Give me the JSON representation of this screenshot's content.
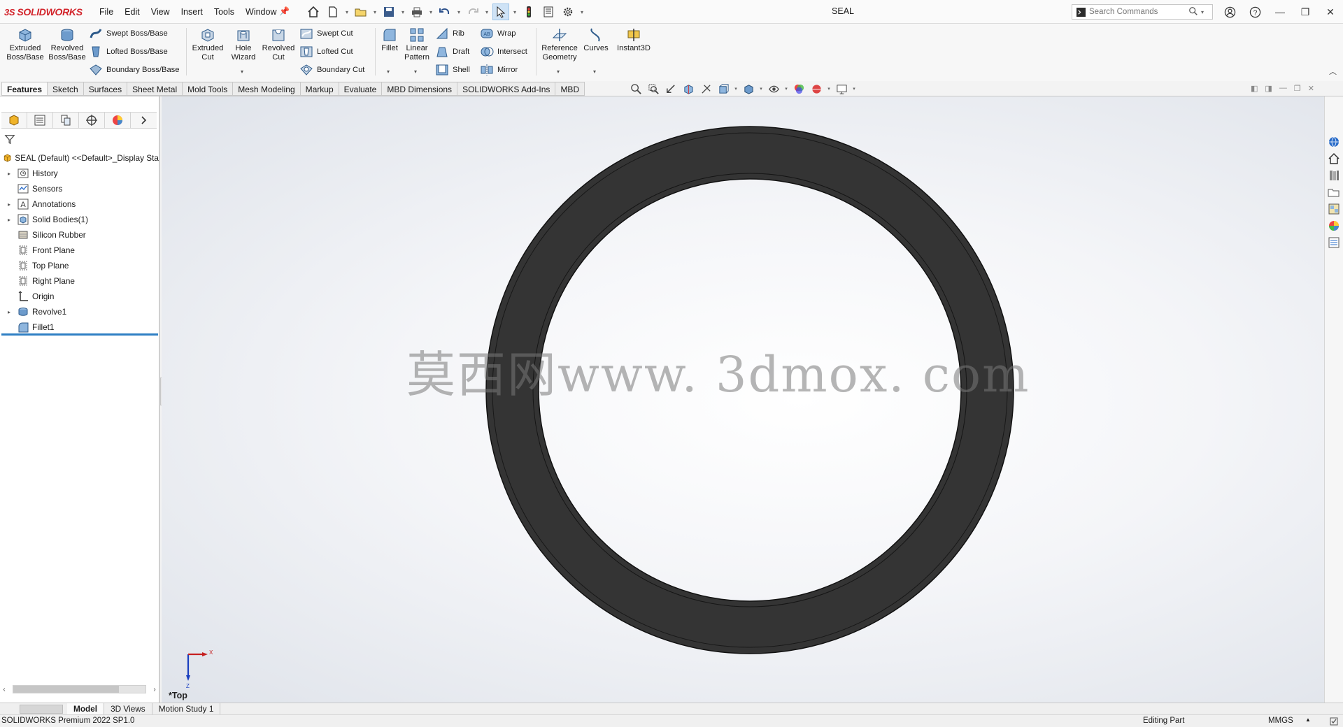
{
  "app": {
    "brand_prefix": "3S",
    "brand": "SOLIDWORKS",
    "document_title": "SEAL"
  },
  "menu": [
    "File",
    "Edit",
    "View",
    "Insert",
    "Tools",
    "Window"
  ],
  "search": {
    "placeholder": "Search Commands"
  },
  "ribbon": {
    "extruded_boss": "Extruded Boss/Base",
    "revolved_boss": "Revolved Boss/Base",
    "swept_boss": "Swept Boss/Base",
    "lofted_boss": "Lofted Boss/Base",
    "boundary_boss": "Boundary Boss/Base",
    "extruded_cut": "Extruded Cut",
    "hole_wizard": "Hole Wizard",
    "revolved_cut": "Revolved Cut",
    "swept_cut": "Swept Cut",
    "lofted_cut": "Lofted Cut",
    "boundary_cut": "Boundary Cut",
    "fillet": "Fillet",
    "linear_pattern": "Linear Pattern",
    "rib": "Rib",
    "draft": "Draft",
    "shell": "Shell",
    "wrap": "Wrap",
    "intersect": "Intersect",
    "mirror": "Mirror",
    "reference_geometry": "Reference Geometry",
    "curves": "Curves",
    "instant3d": "Instant3D"
  },
  "tabs": [
    "Features",
    "Sketch",
    "Surfaces",
    "Sheet Metal",
    "Mold Tools",
    "Mesh Modeling",
    "Markup",
    "Evaluate",
    "MBD Dimensions",
    "SOLIDWORKS Add-Ins",
    "MBD"
  ],
  "tree": {
    "root": "SEAL (Default) <<Default>_Display Sta",
    "items": [
      {
        "label": "History",
        "icon": "history-icon",
        "expandable": true
      },
      {
        "label": "Sensors",
        "icon": "sensors-icon",
        "expandable": false
      },
      {
        "label": "Annotations",
        "icon": "annotations-icon",
        "expandable": true
      },
      {
        "label": "Solid Bodies(1)",
        "icon": "solid-bodies-icon",
        "expandable": true
      },
      {
        "label": "Silicon Rubber",
        "icon": "material-icon",
        "expandable": false
      },
      {
        "label": "Front Plane",
        "icon": "plane-icon",
        "expandable": false
      },
      {
        "label": "Top Plane",
        "icon": "plane-icon",
        "expandable": false
      },
      {
        "label": "Right Plane",
        "icon": "plane-icon",
        "expandable": false
      },
      {
        "label": "Origin",
        "icon": "origin-icon",
        "expandable": false
      },
      {
        "label": "Revolve1",
        "icon": "revolve-icon",
        "expandable": true
      },
      {
        "label": "Fillet1",
        "icon": "fillet-icon",
        "expandable": false
      }
    ]
  },
  "viewport": {
    "watermark": "莫西网www. 3dmox. com",
    "view_name": "*Top",
    "triad_x": "X",
    "triad_z": "Z",
    "model_color": "#333333"
  },
  "bottom_tabs": [
    "Model",
    "3D Views",
    "Motion Study 1"
  ],
  "status": {
    "version": "SOLIDWORKS Premium 2022 SP1.0",
    "mode": "Editing Part",
    "units": "MMGS"
  },
  "colors": {
    "brand_red": "#d2232a",
    "accent_blue": "#2e7fc4"
  }
}
